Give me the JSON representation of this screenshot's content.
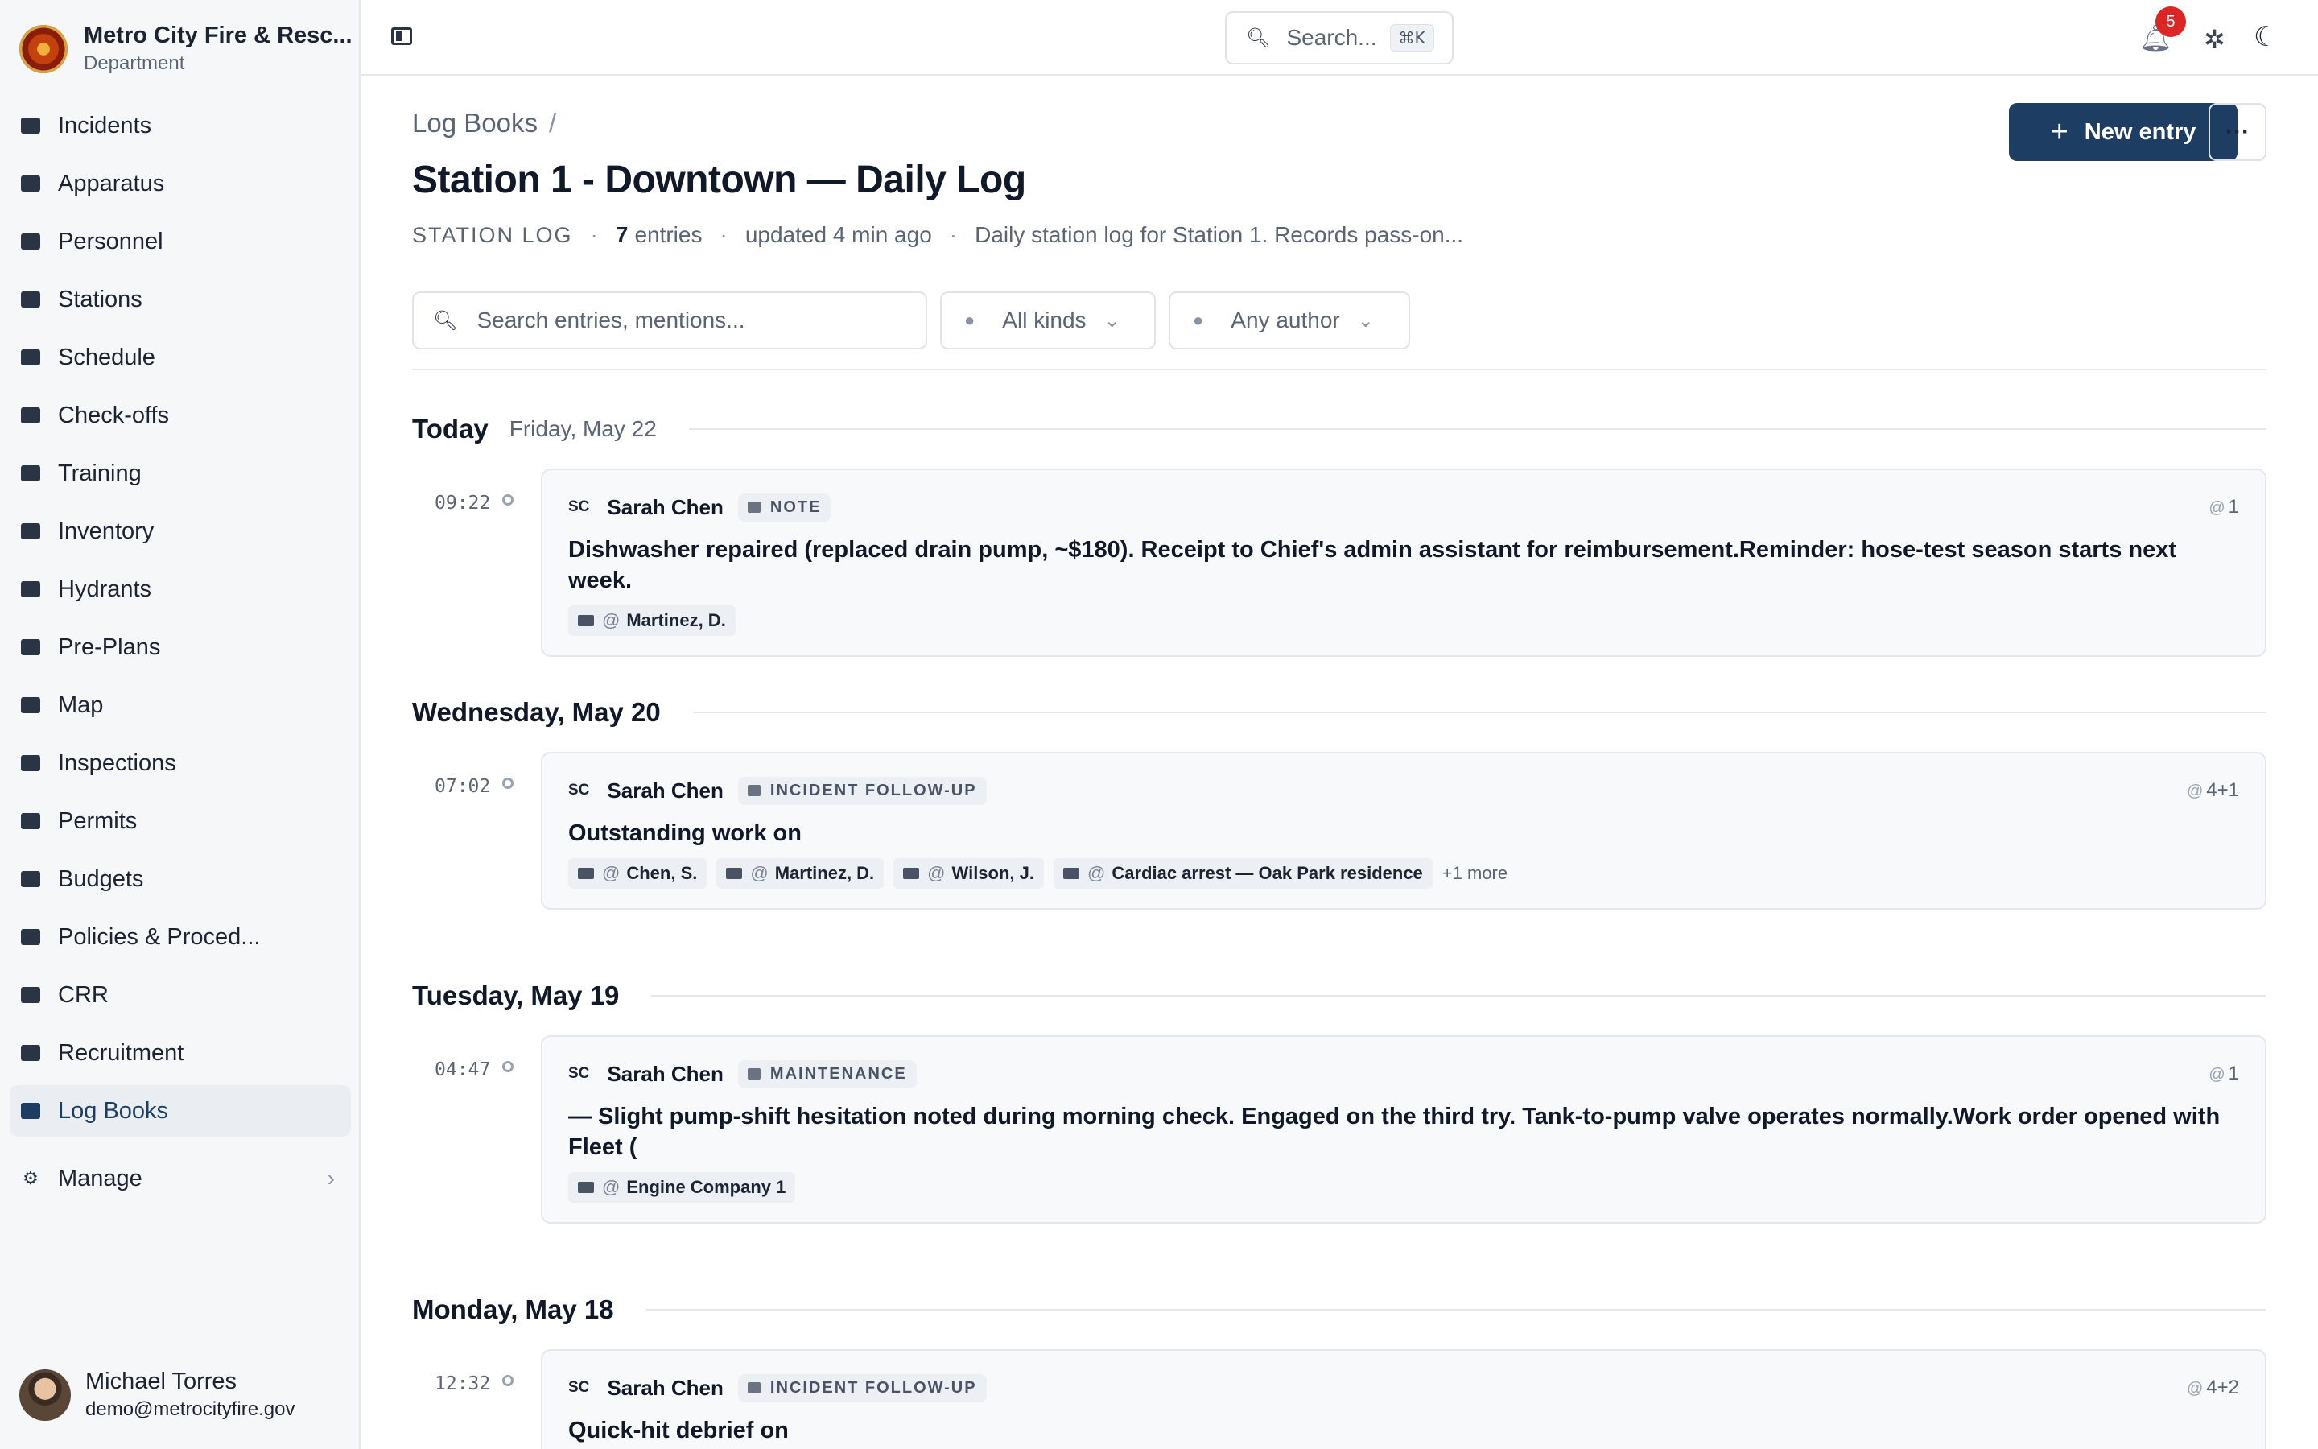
{
  "app": {
    "name": "Metro City Fire & Resc...",
    "subtitle": "Department"
  },
  "nav": {
    "items": [
      {
        "label": "Incidents",
        "icon": "incidents-icon"
      },
      {
        "label": "Apparatus",
        "icon": "apparatus-icon"
      },
      {
        "label": "Personnel",
        "icon": "personnel-icon"
      },
      {
        "label": "Stations",
        "icon": "stations-icon"
      },
      {
        "label": "Schedule",
        "icon": "calendar-icon"
      },
      {
        "label": "Check-offs",
        "icon": "clipboard-icon"
      },
      {
        "label": "Training",
        "icon": "graduation-cap-icon"
      },
      {
        "label": "Inventory",
        "icon": "wrench-icon"
      },
      {
        "label": "Hydrants",
        "icon": "hydrant-icon"
      },
      {
        "label": "Pre-Plans",
        "icon": "building-icon"
      },
      {
        "label": "Map",
        "icon": "map-icon"
      },
      {
        "label": "Inspections",
        "icon": "inspection-icon"
      },
      {
        "label": "Permits",
        "icon": "permit-icon"
      },
      {
        "label": "Budgets",
        "icon": "budget-icon"
      },
      {
        "label": "Policies & Proced...",
        "icon": "book-icon"
      },
      {
        "label": "CRR",
        "icon": "megaphone-icon"
      },
      {
        "label": "Recruitment",
        "icon": "handshake-icon"
      },
      {
        "label": "Log Books",
        "icon": "logbook-icon",
        "active": true
      }
    ],
    "manage_label": "Manage"
  },
  "user": {
    "name": "Michael Torres",
    "email": "demo@metrocityfire.gov"
  },
  "topbar": {
    "search_placeholder": "Search...",
    "search_shortcut": "⌘K",
    "notification_count": "5"
  },
  "page": {
    "breadcrumb_root": "Log Books",
    "breadcrumb_sep": "/",
    "title": "Station 1 - Downtown — Daily Log",
    "kind": "STATION LOG",
    "entry_count": "7",
    "entry_word": "entries",
    "updated": "updated 4 min ago",
    "description": "Daily station log for Station 1. Records pass-on...",
    "new_entry_label": "New entry",
    "more_label": "···"
  },
  "filters": {
    "search_placeholder": "Search entries, mentions...",
    "kinds_label": "All kinds",
    "author_label": "Any author"
  },
  "days": [
    {
      "title": "Today",
      "subtitle": "Friday, May 22",
      "entries": [
        {
          "time": "09:22",
          "initials": "SC",
          "author": "Sarah Chen",
          "kind": "NOTE",
          "mentions": "1",
          "body": "Dishwasher repaired (replaced drain pump, ~$180). Receipt to Chief's admin assistant for reimbursement.Reminder: hose-test season starts next week.",
          "tags": [
            "Martinez, D."
          ],
          "more": ""
        }
      ]
    },
    {
      "title": "Wednesday, May 20",
      "subtitle": "",
      "entries": [
        {
          "time": "07:02",
          "initials": "SC",
          "author": "Sarah Chen",
          "kind": "INCIDENT FOLLOW-UP",
          "mentions": "4+1",
          "body": "Outstanding work on",
          "tags": [
            "Chen, S.",
            "Martinez, D.",
            "Wilson, J.",
            "Cardiac arrest — Oak Park residence"
          ],
          "more": "+1 more"
        }
      ]
    },
    {
      "title": "Tuesday, May 19",
      "subtitle": "",
      "entries": [
        {
          "time": "04:47",
          "initials": "SC",
          "author": "Sarah Chen",
          "kind": "MAINTENANCE",
          "mentions": "1",
          "body": "— Slight pump-shift hesitation noted during morning check. Engaged on the third try. Tank-to-pump valve operates normally.Work order opened with Fleet (",
          "tags": [
            "Engine Company 1"
          ],
          "more": ""
        }
      ]
    },
    {
      "title": "Monday, May 18",
      "subtitle": "",
      "entries": [
        {
          "time": "12:32",
          "initials": "SC",
          "author": "Sarah Chen",
          "kind": "INCIDENT FOLLOW-UP",
          "mentions": "4+2",
          "body": "Quick-hit debrief on",
          "tags": [],
          "more": ""
        }
      ]
    }
  ],
  "colors": {
    "primary": "#1d3d63",
    "badge": "#dc2626",
    "sidebar_bg": "#f6f7f9"
  }
}
